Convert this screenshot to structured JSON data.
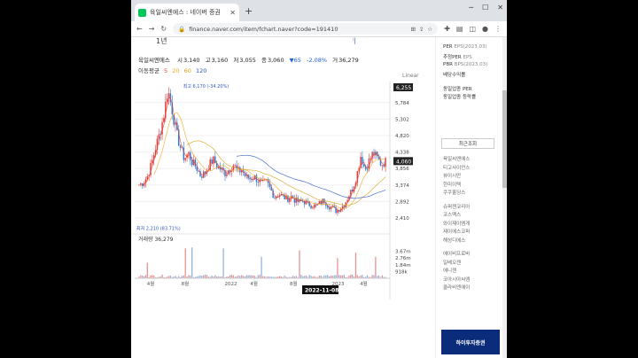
{
  "browser": {
    "tab_title": "육일씨엔에스 : 네이버 증권",
    "url": "finance.naver.com/item/fchart.naver?code=191410"
  },
  "header": {
    "period": "1년"
  },
  "info": {
    "name": "육일씨엔에스",
    "open_label": "시",
    "open": "3,140",
    "high_label": "고",
    "high": "3,160",
    "low_label": "저",
    "low": "3,055",
    "close_label": "종",
    "close": "3,060",
    "change": "▼65",
    "change_pct": "-2.08%",
    "volume_label": "거",
    "volume": "36,279"
  },
  "moving_average": {
    "label": "이동평균",
    "periods": [
      "5",
      "20",
      "60",
      "120"
    ],
    "colors": [
      "#e9442f",
      "#f5a623",
      "#d4a017",
      "#2b56c8"
    ]
  },
  "scale_mode": "Linear",
  "chart_data": [
    {
      "type": "candlestick",
      "title": "",
      "y_ticks": [
        5784,
        5302,
        4820,
        4338,
        3856,
        3374,
        2892,
        2410
      ],
      "ylim": [
        2150,
        6400
      ],
      "price_tag_high": "6,255",
      "price_tag_current": "4,060",
      "max_annotation": "최고 6,170 (-34.20%)",
      "min_annotation": "최저 2,210 (83.71%)",
      "x_ticks": [
        "4월",
        "8월",
        "2022",
        "4월",
        "8월",
        "2023",
        "4월"
      ],
      "x_tick_positions": [
        0.065,
        0.2,
        0.37,
        0.47,
        0.625,
        0.79,
        0.9
      ],
      "crosshair_date": "2022-11-08",
      "close_path": [
        3380,
        3450,
        3620,
        3980,
        4450,
        4880,
        5400,
        6170,
        5600,
        4950,
        4500,
        4150,
        4300,
        4020,
        3880,
        3650,
        3720,
        3950,
        4120,
        3930,
        3820,
        3720,
        3850,
        3980,
        3760,
        3820,
        3600,
        3560,
        3620,
        3510,
        3400,
        3460,
        3250,
        3020,
        3120,
        3040,
        2960,
        3050,
        2920,
        2870,
        2910,
        2830,
        2780,
        2760,
        2840,
        2930,
        2780,
        2710,
        2620,
        2700,
        2820,
        3050,
        3280,
        3660,
        4250,
        3820,
        4080,
        4320,
        4150,
        3980,
        4060
      ]
    },
    {
      "type": "bar",
      "title": "거래량 36,279",
      "y_ticks": [
        "3.67m",
        "2.76m",
        "1.84m",
        "918k"
      ],
      "ylim": [
        0,
        4600000
      ]
    }
  ],
  "sidebar": {
    "per_label": "PER",
    "per_eps": "EPS(2023.03)",
    "est_per_label": "추정PER",
    "est_eps": "EPS",
    "pbr_label": "PBR",
    "pbr_bps": "BPS(2023.03)",
    "dividend_label": "배당수익률",
    "same_industry_per": "동일업종 PER",
    "same_industry_change": "동일업종 등락률",
    "recent_tab": "최근조회",
    "recent_items": [
      "육일씨엔에스",
      "티고사이언스",
      "뷰이시만",
      "한미이텍",
      "쿠쿠홀딩스",
      "슈퍼젠코리아",
      "코스맥스",
      "와이제이엠게",
      "제이에스코퍼",
      "해성디에스",
      "에이비프로바",
      "일베오젠",
      "에니젠",
      "코아시아씨엠",
      "클라비엔에이"
    ],
    "banner": "하이투자증권"
  }
}
